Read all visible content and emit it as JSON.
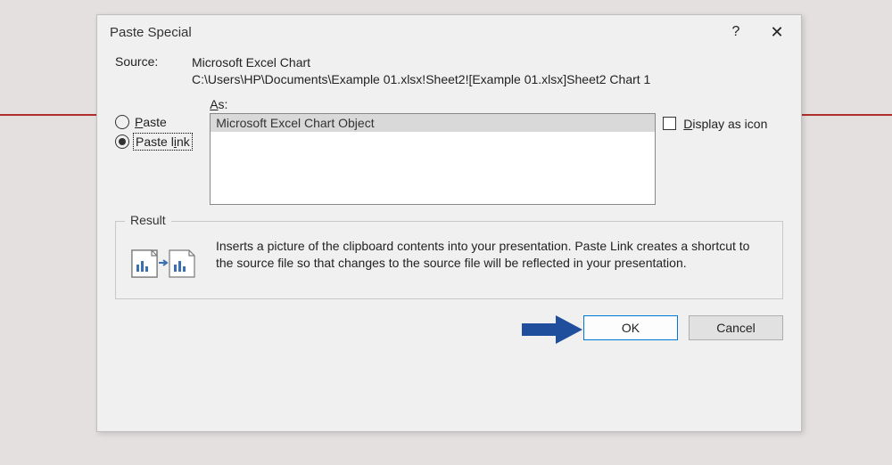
{
  "dialog": {
    "title": "Paste Special",
    "help_symbol": "?",
    "close_symbol": "✕"
  },
  "source": {
    "label": "Source:",
    "line1": "Microsoft Excel Chart",
    "line2": "C:\\Users\\HP\\Documents\\Example 01.xlsx!Sheet2![Example 01.xlsx]Sheet2 Chart 1"
  },
  "radios": {
    "paste": {
      "accel": "P",
      "rest": "aste"
    },
    "paste_link": {
      "before": "Paste l",
      "accel": "i",
      "after": "nk"
    }
  },
  "as": {
    "accel": "A",
    "rest": "s:",
    "items": [
      "Microsoft Excel Chart Object"
    ]
  },
  "display_as_icon": {
    "accel": "D",
    "rest": "isplay as icon"
  },
  "result": {
    "legend": "Result",
    "text": "Inserts a picture of the clipboard contents into your presentation. Paste Link creates a shortcut to the source file so that changes to the source file will be reflected in your presentation."
  },
  "buttons": {
    "ok": "OK",
    "cancel": "Cancel"
  }
}
